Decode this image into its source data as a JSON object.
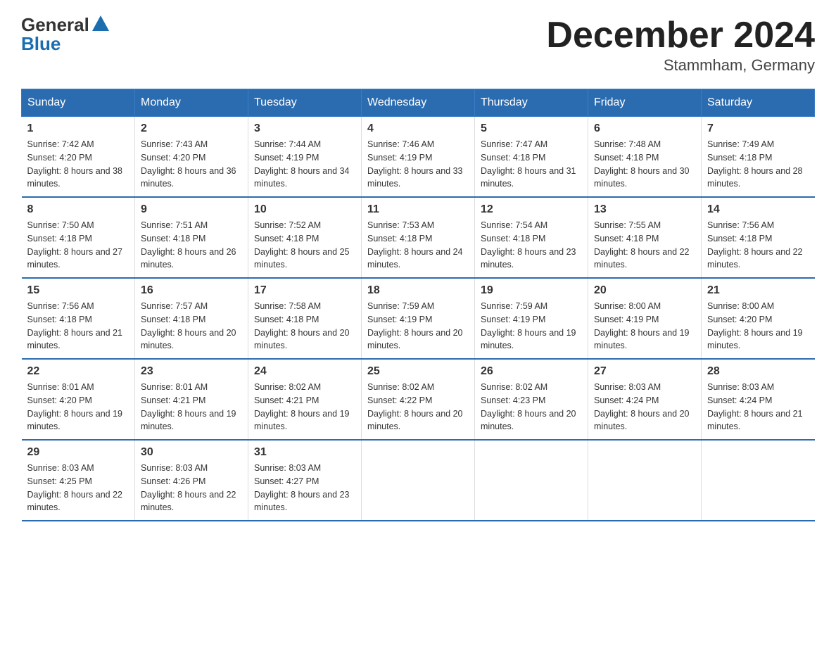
{
  "header": {
    "logo_general": "General",
    "logo_blue": "Blue",
    "title": "December 2024",
    "subtitle": "Stammham, Germany"
  },
  "weekdays": [
    "Sunday",
    "Monday",
    "Tuesday",
    "Wednesday",
    "Thursday",
    "Friday",
    "Saturday"
  ],
  "weeks": [
    [
      {
        "day": "1",
        "sunrise": "7:42 AM",
        "sunset": "4:20 PM",
        "daylight": "8 hours and 38 minutes."
      },
      {
        "day": "2",
        "sunrise": "7:43 AM",
        "sunset": "4:20 PM",
        "daylight": "8 hours and 36 minutes."
      },
      {
        "day": "3",
        "sunrise": "7:44 AM",
        "sunset": "4:19 PM",
        "daylight": "8 hours and 34 minutes."
      },
      {
        "day": "4",
        "sunrise": "7:46 AM",
        "sunset": "4:19 PM",
        "daylight": "8 hours and 33 minutes."
      },
      {
        "day": "5",
        "sunrise": "7:47 AM",
        "sunset": "4:18 PM",
        "daylight": "8 hours and 31 minutes."
      },
      {
        "day": "6",
        "sunrise": "7:48 AM",
        "sunset": "4:18 PM",
        "daylight": "8 hours and 30 minutes."
      },
      {
        "day": "7",
        "sunrise": "7:49 AM",
        "sunset": "4:18 PM",
        "daylight": "8 hours and 28 minutes."
      }
    ],
    [
      {
        "day": "8",
        "sunrise": "7:50 AM",
        "sunset": "4:18 PM",
        "daylight": "8 hours and 27 minutes."
      },
      {
        "day": "9",
        "sunrise": "7:51 AM",
        "sunset": "4:18 PM",
        "daylight": "8 hours and 26 minutes."
      },
      {
        "day": "10",
        "sunrise": "7:52 AM",
        "sunset": "4:18 PM",
        "daylight": "8 hours and 25 minutes."
      },
      {
        "day": "11",
        "sunrise": "7:53 AM",
        "sunset": "4:18 PM",
        "daylight": "8 hours and 24 minutes."
      },
      {
        "day": "12",
        "sunrise": "7:54 AM",
        "sunset": "4:18 PM",
        "daylight": "8 hours and 23 minutes."
      },
      {
        "day": "13",
        "sunrise": "7:55 AM",
        "sunset": "4:18 PM",
        "daylight": "8 hours and 22 minutes."
      },
      {
        "day": "14",
        "sunrise": "7:56 AM",
        "sunset": "4:18 PM",
        "daylight": "8 hours and 22 minutes."
      }
    ],
    [
      {
        "day": "15",
        "sunrise": "7:56 AM",
        "sunset": "4:18 PM",
        "daylight": "8 hours and 21 minutes."
      },
      {
        "day": "16",
        "sunrise": "7:57 AM",
        "sunset": "4:18 PM",
        "daylight": "8 hours and 20 minutes."
      },
      {
        "day": "17",
        "sunrise": "7:58 AM",
        "sunset": "4:18 PM",
        "daylight": "8 hours and 20 minutes."
      },
      {
        "day": "18",
        "sunrise": "7:59 AM",
        "sunset": "4:19 PM",
        "daylight": "8 hours and 20 minutes."
      },
      {
        "day": "19",
        "sunrise": "7:59 AM",
        "sunset": "4:19 PM",
        "daylight": "8 hours and 19 minutes."
      },
      {
        "day": "20",
        "sunrise": "8:00 AM",
        "sunset": "4:19 PM",
        "daylight": "8 hours and 19 minutes."
      },
      {
        "day": "21",
        "sunrise": "8:00 AM",
        "sunset": "4:20 PM",
        "daylight": "8 hours and 19 minutes."
      }
    ],
    [
      {
        "day": "22",
        "sunrise": "8:01 AM",
        "sunset": "4:20 PM",
        "daylight": "8 hours and 19 minutes."
      },
      {
        "day": "23",
        "sunrise": "8:01 AM",
        "sunset": "4:21 PM",
        "daylight": "8 hours and 19 minutes."
      },
      {
        "day": "24",
        "sunrise": "8:02 AM",
        "sunset": "4:21 PM",
        "daylight": "8 hours and 19 minutes."
      },
      {
        "day": "25",
        "sunrise": "8:02 AM",
        "sunset": "4:22 PM",
        "daylight": "8 hours and 20 minutes."
      },
      {
        "day": "26",
        "sunrise": "8:02 AM",
        "sunset": "4:23 PM",
        "daylight": "8 hours and 20 minutes."
      },
      {
        "day": "27",
        "sunrise": "8:03 AM",
        "sunset": "4:24 PM",
        "daylight": "8 hours and 20 minutes."
      },
      {
        "day": "28",
        "sunrise": "8:03 AM",
        "sunset": "4:24 PM",
        "daylight": "8 hours and 21 minutes."
      }
    ],
    [
      {
        "day": "29",
        "sunrise": "8:03 AM",
        "sunset": "4:25 PM",
        "daylight": "8 hours and 22 minutes."
      },
      {
        "day": "30",
        "sunrise": "8:03 AM",
        "sunset": "4:26 PM",
        "daylight": "8 hours and 22 minutes."
      },
      {
        "day": "31",
        "sunrise": "8:03 AM",
        "sunset": "4:27 PM",
        "daylight": "8 hours and 23 minutes."
      },
      null,
      null,
      null,
      null
    ]
  ]
}
